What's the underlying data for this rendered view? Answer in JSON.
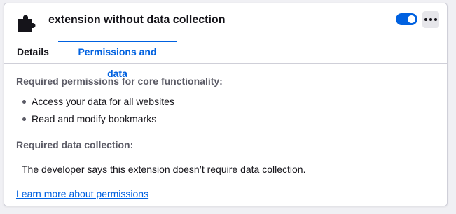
{
  "extension": {
    "name": "extension without data collection",
    "enabled": true,
    "icon": "puzzle-piece-icon",
    "more_icon": "more-options-icon"
  },
  "tabs": [
    {
      "label": "Details",
      "selected": false
    },
    {
      "label": "Permissions and data",
      "selected": true
    }
  ],
  "permissions": {
    "heading": "Required permissions for core functionality:",
    "items": [
      "Access your data for all websites",
      "Read and modify bookmarks"
    ]
  },
  "data_collection": {
    "heading": "Required data collection:",
    "text": "The developer says this extension doesn’t require data collection."
  },
  "learn_more": {
    "label": "Learn more about permissions"
  },
  "colors": {
    "accent": "#0061e0",
    "card_background": "#ffffff",
    "page_background": "#f0f0f4",
    "secondary_text": "#5b5b66"
  }
}
